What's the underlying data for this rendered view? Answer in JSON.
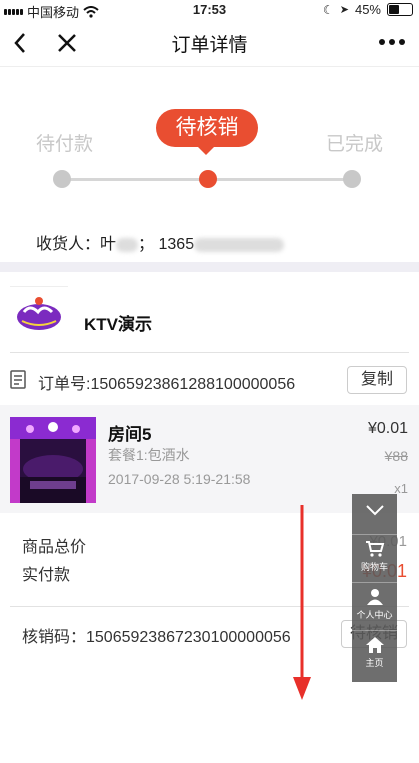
{
  "status_bar": {
    "carrier": "中国移动",
    "time": "17:53",
    "battery": "45%",
    "battery_level": 0.45
  },
  "navbar": {
    "title": "订单详情"
  },
  "progress": {
    "steps": [
      "待付款",
      "待核销",
      "已完成"
    ],
    "active_step": 1
  },
  "receiver": {
    "label": "收货人：",
    "name_visible": "叶",
    "separator": "；",
    "phone_visible": "1365"
  },
  "shop": {
    "name": "KTV演示"
  },
  "order": {
    "number_text": "订单号:15065923861288100000056",
    "copy_label": "复制"
  },
  "item": {
    "name": "房间5",
    "package": "套餐1:包酒水",
    "time": "2017-09-28 5:19-21:58",
    "price": "¥0.01",
    "original_price": "¥88",
    "quantity": "x1"
  },
  "summary": {
    "total_label": "商品总价",
    "total_value": "¥0.01",
    "paid_label": "实付款",
    "paid_value": "¥0.01"
  },
  "verify": {
    "code_text": "核销码：15065923867230100000056",
    "button_label": "待核销"
  },
  "float_menu": {
    "items": [
      {
        "label": "",
        "icon": "chevron-down-icon"
      },
      {
        "label": "购物车",
        "icon": "cart-icon"
      },
      {
        "label": "个人中心",
        "icon": "person-icon"
      },
      {
        "label": "主页",
        "icon": "home-icon"
      }
    ]
  },
  "colors": {
    "accent": "#e94e31",
    "muted": "#c8c8c8",
    "section_bg": "#efeef4"
  }
}
